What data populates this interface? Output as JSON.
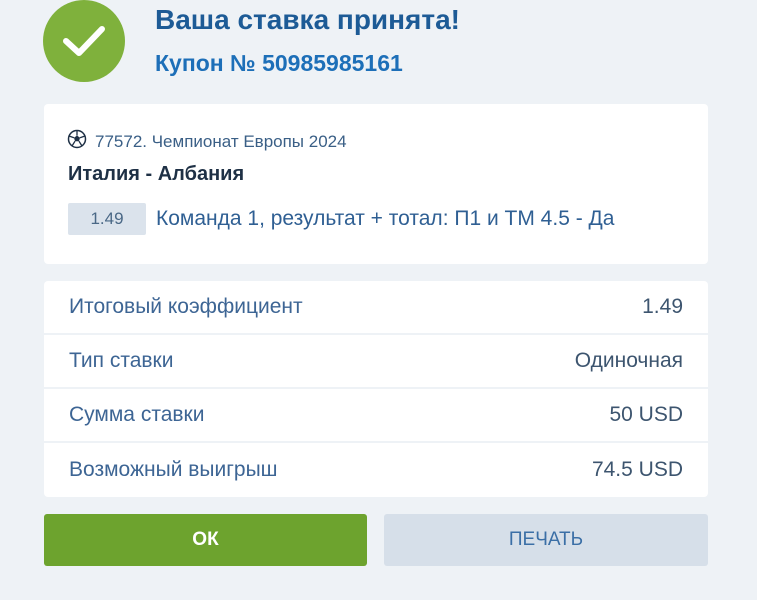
{
  "header": {
    "title": "Ваша ставка принята!",
    "coupon": "Купон № 50985985161"
  },
  "bet_card": {
    "event": "77572. Чемпионат Европы 2024",
    "sport_icon": "soccer-ball-icon",
    "match": "Италия - Албания",
    "odds": "1.49",
    "selection": "Команда 1, результат + тотал: П1 и ТМ 4.5 - Да"
  },
  "summary": [
    {
      "label": "Итоговый коэффициент",
      "value": "1.49"
    },
    {
      "label": "Тип ставки",
      "value": "Одиночная"
    },
    {
      "label": "Сумма ставки",
      "value": "50 USD"
    },
    {
      "label": "Возможный выигрыш",
      "value": "74.5 USD"
    }
  ],
  "buttons": {
    "ok": "ОК",
    "print": "ПЕЧАТЬ"
  },
  "colors": {
    "success_green": "#7fb13c",
    "ok_button": "#6da32e",
    "title_blue": "#1d5b96",
    "background": "#eef2f6"
  }
}
